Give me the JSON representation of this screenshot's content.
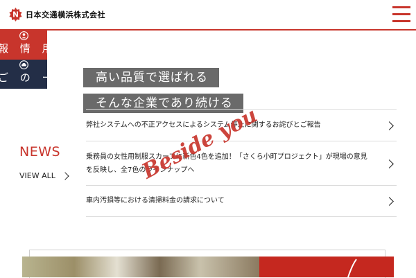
{
  "header": {
    "logo_mark": "N",
    "logo_text": "日本交通横浜株式会社",
    "menu_icon": "hamburger-menu-icon",
    "accent_color": "#c8352c"
  },
  "side_tabs": [
    {
      "label": "報 情 用 採",
      "icon": "person-icon",
      "color": "#c8352c"
    },
    {
      "label": "ご の ー ヤ",
      "icon": "car-icon",
      "color": "#232e47"
    }
  ],
  "catch_copy": {
    "line1": "高い品質で選ばれる",
    "line2": "そんな企業であり続ける",
    "script_text": "Beside you"
  },
  "news": {
    "title": "NEWS",
    "view_all": "VIEW ALL",
    "items": [
      {
        "text": "弊社システムへの不正アクセスによるシステム停止に関するお詫びとご報告"
      },
      {
        "text": "乗務員の女性用制服スカーフに新色4色を追加！「さくら小町プロジェクト」が現場の意見を反映し、全7色のラインナップへ"
      },
      {
        "text": "車内汚損等における清掃料金の請求について"
      }
    ]
  }
}
